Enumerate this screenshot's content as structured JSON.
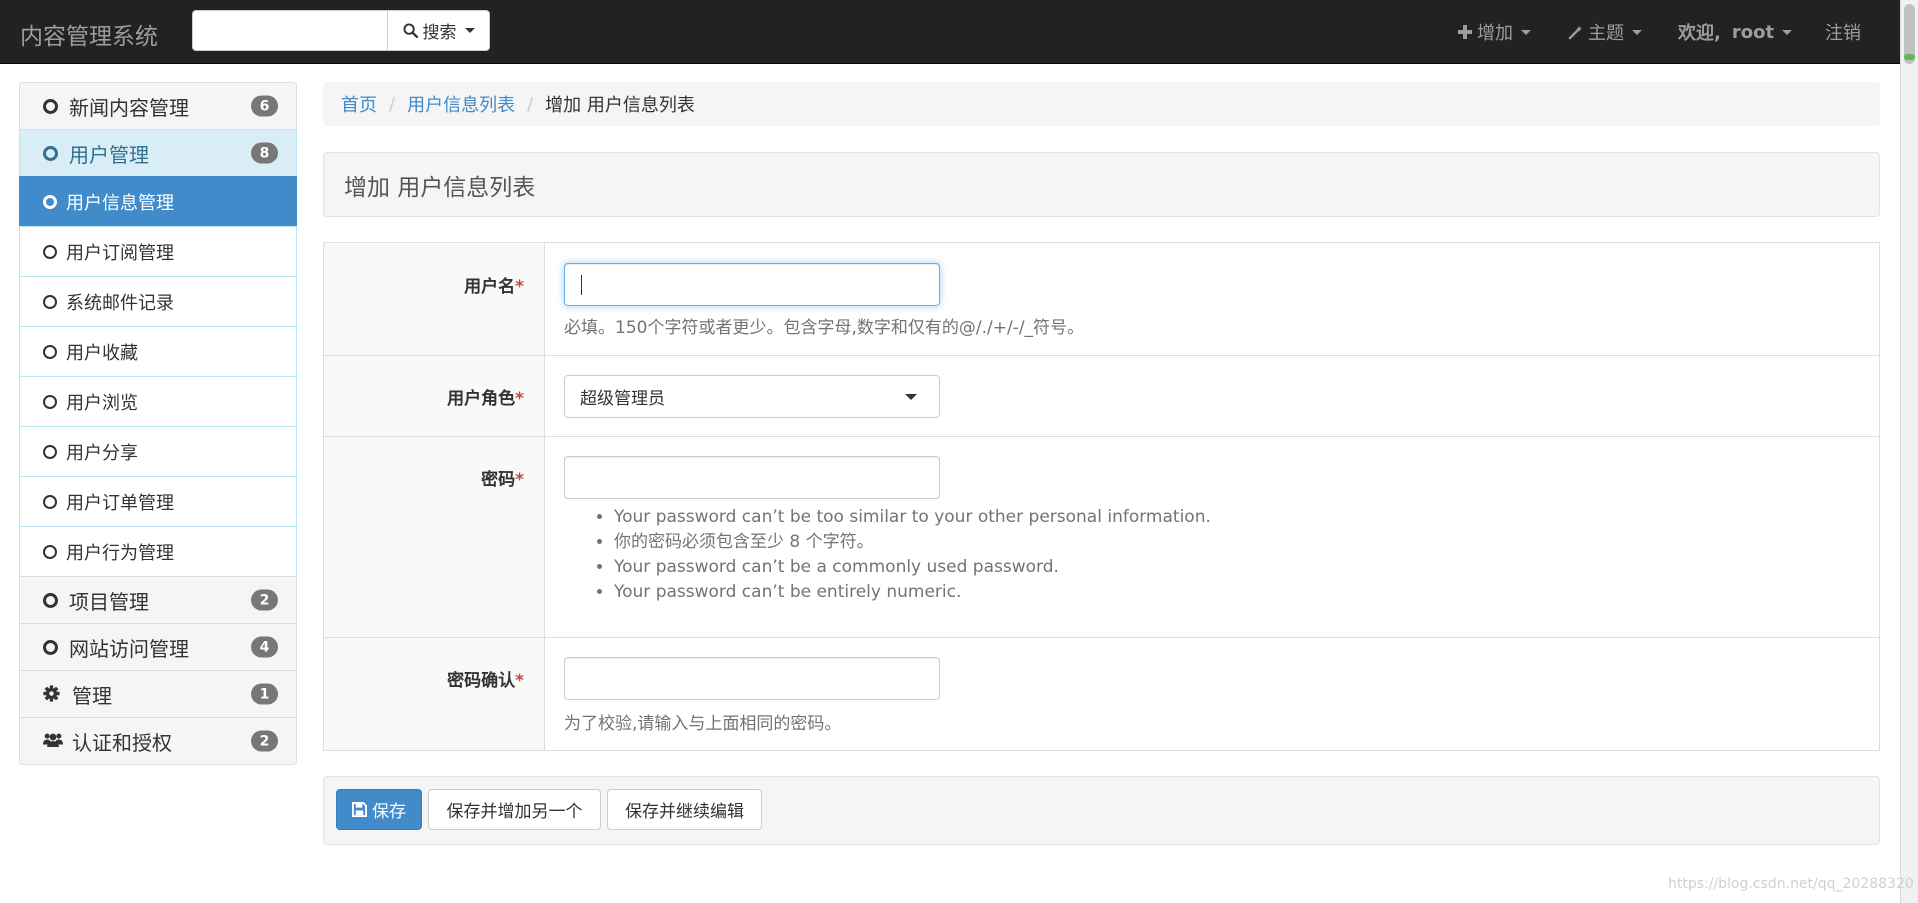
{
  "navbar": {
    "brand": "内容管理系统",
    "search_button_label": "搜索",
    "add_label": "增加",
    "theme_label": "主题",
    "welcome_label": "欢迎,",
    "username": "root",
    "logout_label": "注销"
  },
  "sidebar": {
    "groups": [
      {
        "label": "新闻内容管理",
        "count": "6"
      },
      {
        "label": "用户管理",
        "count": "8"
      },
      {
        "label": "项目管理",
        "count": "2"
      },
      {
        "label": "网站访问管理",
        "count": "4"
      },
      {
        "label": "管理",
        "count": "1"
      },
      {
        "label": "认证和授权",
        "count": "2"
      }
    ],
    "sub_items": [
      {
        "label": "用户信息管理"
      },
      {
        "label": "用户订阅管理"
      },
      {
        "label": "系统邮件记录"
      },
      {
        "label": "用户收藏"
      },
      {
        "label": "用户浏览"
      },
      {
        "label": "用户分享"
      },
      {
        "label": "用户订单管理"
      },
      {
        "label": "用户行为管理"
      }
    ]
  },
  "breadcrumb": {
    "home": "首页",
    "list": "用户信息列表",
    "current": "增加 用户信息列表"
  },
  "page_title": "增加 用户信息列表",
  "form": {
    "username": {
      "label": "用户名",
      "required_mark": "*",
      "value": "",
      "help": "必填。150个字符或者更少。包含字母,数字和仅有的@/./+/-/_符号。"
    },
    "role": {
      "label": "用户角色",
      "required_mark": "*",
      "selected": "超级管理员"
    },
    "password": {
      "label": "密码",
      "required_mark": "*",
      "value": "",
      "help_items": [
        "Your password can’t be too similar to your other personal information.",
        "你的密码必须包含至少 8 个字符。",
        "Your password can’t be a commonly used password.",
        "Your password can’t be entirely numeric."
      ]
    },
    "password_confirm": {
      "label": "密码确认",
      "required_mark": "*",
      "value": "",
      "help": "为了校验,请输入与上面相同的密码。"
    }
  },
  "actions": {
    "save": "保存",
    "save_add_another": "保存并增加另一个",
    "save_continue": "保存并继续编辑"
  },
  "watermark": "https://blog.csdn.net/qq_20288320",
  "colors": {
    "navbar_bg": "#222222",
    "primary": "#428bca",
    "active_group_bg": "#d9edf7",
    "badge": "#777777",
    "required": "#b94a48"
  }
}
